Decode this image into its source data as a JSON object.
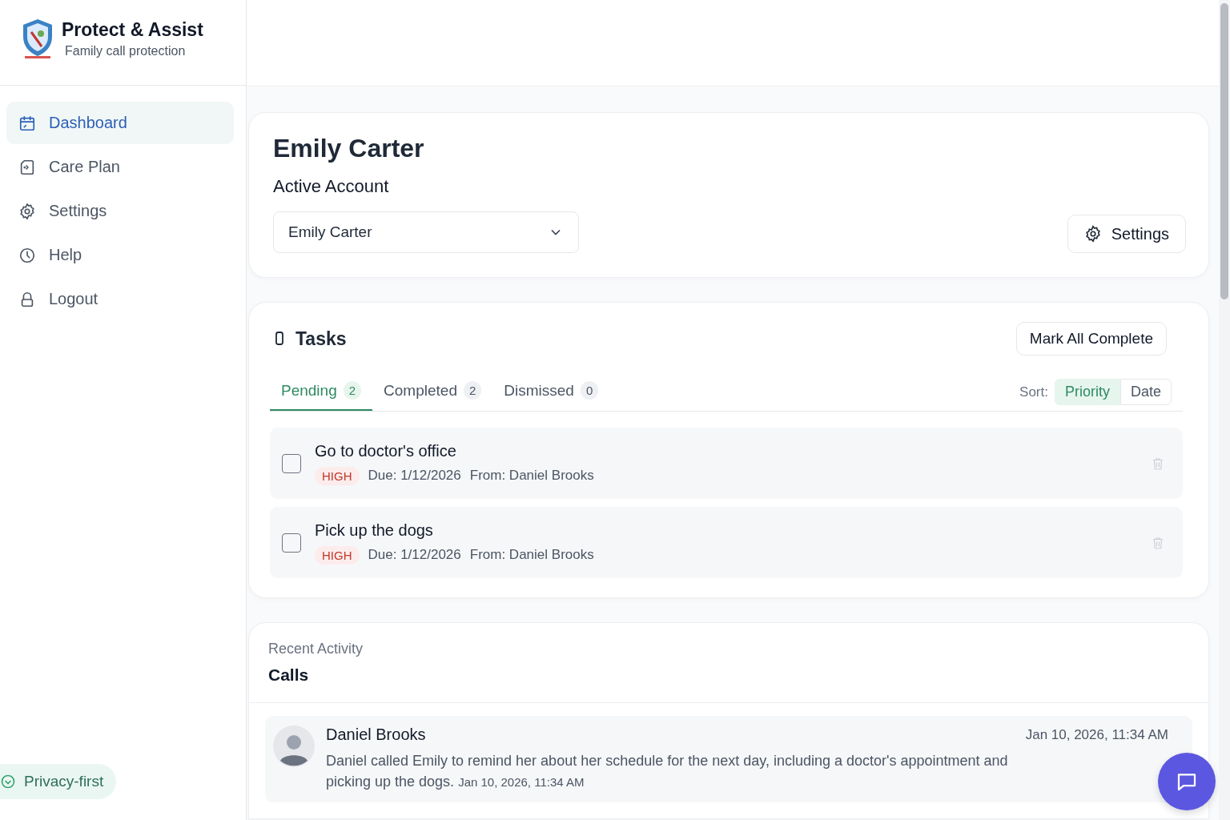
{
  "brand": {
    "name": "Protect & Assist",
    "tagline": "Family call protection"
  },
  "sidebar": {
    "items": [
      {
        "label": "Dashboard",
        "selected": true
      },
      {
        "label": "Care Plan",
        "selected": false
      },
      {
        "label": "Settings",
        "selected": false
      },
      {
        "label": "Help",
        "selected": false
      },
      {
        "label": "Logout",
        "selected": false
      }
    ],
    "badge": "Privacy-first"
  },
  "account": {
    "name": "Emily Carter",
    "label": "Active Account",
    "dropdown_value": "Emily Carter",
    "settings_button": "Settings"
  },
  "tasks": {
    "title": "Tasks",
    "mark_all_button": "Mark All Complete",
    "tabs": [
      {
        "label": "Pending",
        "count": "2",
        "selected": true
      },
      {
        "label": "Completed",
        "count": "2",
        "selected": false
      },
      {
        "label": "Dismissed",
        "count": "0",
        "selected": false
      }
    ],
    "sort": {
      "label": "Sort:",
      "options": [
        {
          "label": "Priority",
          "selected": true
        },
        {
          "label": "Date",
          "selected": false
        }
      ]
    },
    "items": [
      {
        "title": "Go to doctor's office",
        "checked": false,
        "priority": "HIGH",
        "due": "Due: 1/12/2026",
        "from": "From: Daniel Brooks"
      },
      {
        "title": "Pick up the dogs",
        "checked": false,
        "priority": "HIGH",
        "due": "Due: 1/12/2026",
        "from": "From: Daniel Brooks"
      }
    ]
  },
  "activity": {
    "eyebrow": "Recent Activity",
    "title": "Calls",
    "calls": [
      {
        "name": "Daniel Brooks",
        "time": "Jan 10, 2026, 11:34 AM",
        "summary": "Daniel called Emily to remind her about her schedule for the next day, including a doctor's appointment and picking up the dogs.",
        "summary_time": "Jan 10, 2026, 11:34 AM"
      }
    ]
  }
}
